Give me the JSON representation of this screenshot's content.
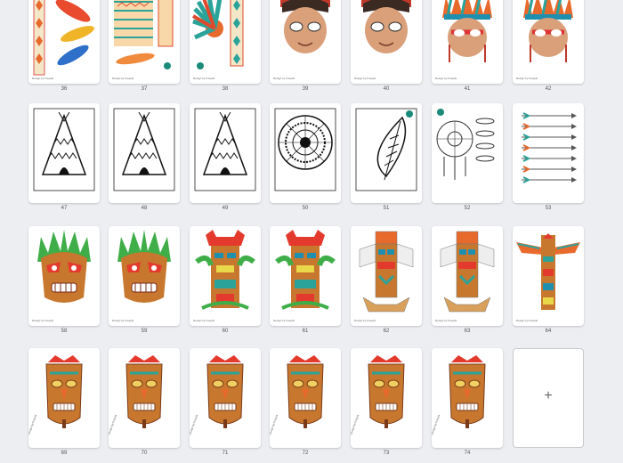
{
  "credit": "Design by Freepik",
  "add_icon": "plus-icon",
  "pages": [
    {
      "num": "36",
      "art": "feather-strip"
    },
    {
      "num": "37",
      "art": "pattern-feathers"
    },
    {
      "num": "38",
      "art": "headdress"
    },
    {
      "num": "39",
      "art": "mask-kid"
    },
    {
      "num": "40",
      "art": "mask-kid"
    },
    {
      "num": "41",
      "art": "mask-headdress"
    },
    {
      "num": "42",
      "art": "mask-headdress"
    },
    {
      "num": "47",
      "art": "teepee-outline"
    },
    {
      "num": "48",
      "art": "teepee-outline"
    },
    {
      "num": "49",
      "art": "teepee-outline"
    },
    {
      "num": "50",
      "art": "mandala"
    },
    {
      "num": "51",
      "art": "feather-outline"
    },
    {
      "num": "52",
      "art": "dreamcatcher"
    },
    {
      "num": "53",
      "art": "arrows"
    },
    {
      "num": "58",
      "art": "tiki-head"
    },
    {
      "num": "59",
      "art": "tiki-head"
    },
    {
      "num": "60",
      "art": "totem"
    },
    {
      "num": "61",
      "art": "totem"
    },
    {
      "num": "62",
      "art": "totem-papercraft"
    },
    {
      "num": "63",
      "art": "totem-papercraft"
    },
    {
      "num": "64",
      "art": "totem-wings"
    },
    {
      "num": "69",
      "art": "tiki-mask"
    },
    {
      "num": "70",
      "art": "tiki-mask"
    },
    {
      "num": "71",
      "art": "tiki-mask"
    },
    {
      "num": "72",
      "art": "tiki-mask"
    },
    {
      "num": "73",
      "art": "tiki-mask"
    },
    {
      "num": "74",
      "art": "tiki-mask"
    }
  ]
}
